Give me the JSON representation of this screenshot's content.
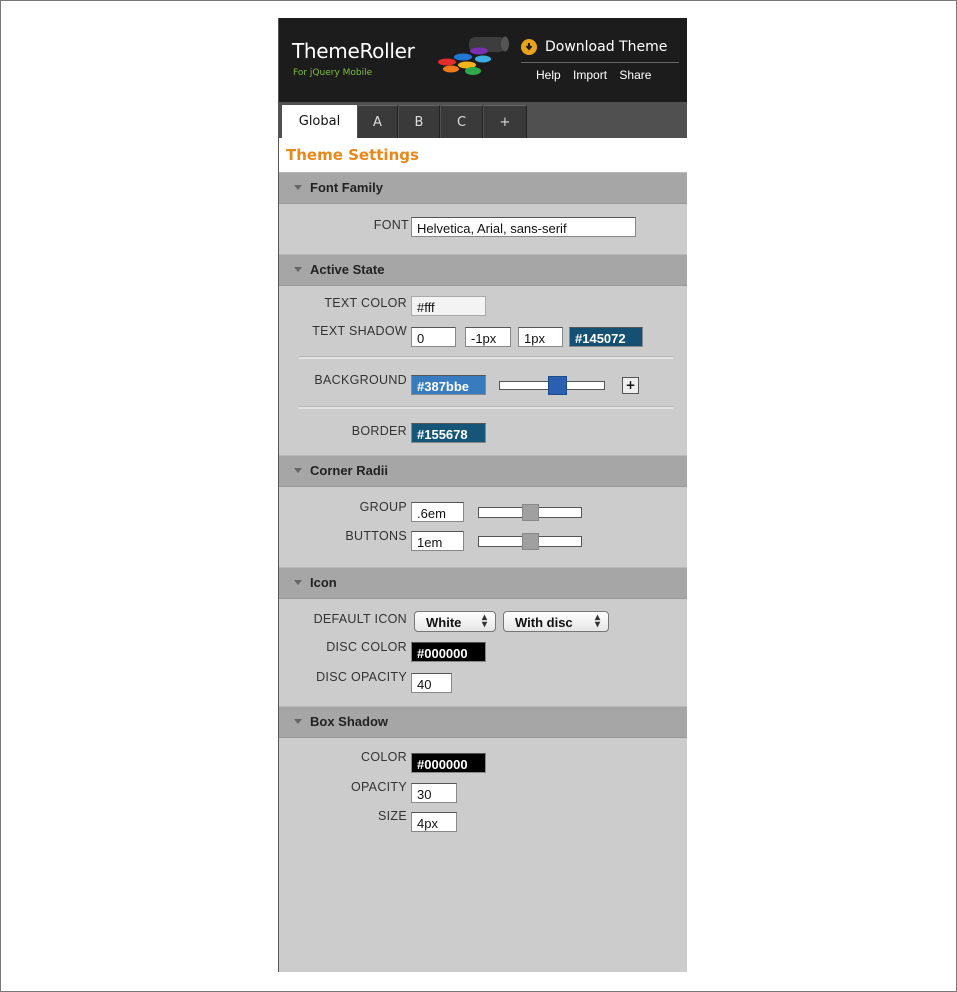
{
  "header": {
    "title": "ThemeRoller",
    "subtitle": "For jQuery Mobile",
    "download_label": "Download Theme",
    "links": [
      "Help",
      "Import",
      "Share"
    ],
    "download_icon": "download-arrow-icon",
    "logo_art_icon": "paint-roller-icon"
  },
  "tabs": [
    "Global",
    "A",
    "B",
    "C",
    "+"
  ],
  "active_tab": "Global",
  "page_title": "Theme Settings",
  "colors": {
    "accent": "#e8881a",
    "download_icon": "#e8a419",
    "header_bg": "#1c1c1c"
  },
  "sections": {
    "font_family": {
      "title": "Font Family",
      "font_label": "FONT",
      "font_value": "Helvetica, Arial, sans-serif"
    },
    "active_state": {
      "title": "Active State",
      "text_color_label": "TEXT COLOR",
      "text_color_value": "#fff",
      "text_shadow_label": "TEXT SHADOW",
      "text_shadow_x": "0",
      "text_shadow_y": "-1px",
      "text_shadow_blur": "1px",
      "text_shadow_color": "#145072",
      "background_label": "BACKGROUND",
      "background_value": "#387bbe",
      "background_slider_level": 0.55,
      "add_stop_label": "+",
      "border_label": "BORDER",
      "border_value": "#155678"
    },
    "corner_radii": {
      "title": "Corner Radii",
      "group_label": "GROUP",
      "group_value": ".6em",
      "group_slider_level": 0.5,
      "buttons_label": "BUTTONS",
      "buttons_value": "1em",
      "buttons_slider_level": 0.5
    },
    "icon": {
      "title": "Icon",
      "default_icon_label": "DEFAULT ICON",
      "default_icon_color": "White",
      "default_icon_disc": "With disc",
      "disc_color_label": "DISC COLOR",
      "disc_color_value": "#000000",
      "disc_opacity_label": "DISC OPACITY",
      "disc_opacity_value": "40"
    },
    "box_shadow": {
      "title": "Box Shadow",
      "color_label": "COLOR",
      "color_value": "#000000",
      "opacity_label": "OPACITY",
      "opacity_value": "30",
      "size_label": "SIZE",
      "size_value": "4px"
    }
  }
}
